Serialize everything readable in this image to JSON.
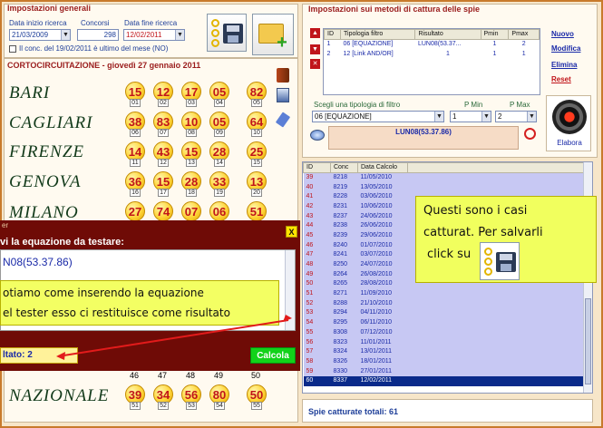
{
  "general": {
    "title": "Impostazioni generali",
    "date_start_label": "Data inizio ricerca",
    "date_start": "21/03/2009",
    "contests_label": "Concorsi",
    "contests": "298",
    "date_end_label": "Data fine ricerca",
    "date_end": "12/02/2011",
    "checkbox_label": "Il conc. del 19/02/2011 è ultimo del mese (NO)"
  },
  "draw": {
    "title": "CORTOCIRCUITAZIONE - giovedì 27 gennaio 2011",
    "wheels": [
      {
        "name": "BARI",
        "numbers": [
          "15",
          "12",
          "17",
          "05",
          "82"
        ],
        "idx": [
          "01",
          "02",
          "03",
          "04",
          "05"
        ]
      },
      {
        "name": "CAGLIARI",
        "numbers": [
          "38",
          "83",
          "10",
          "05",
          "64"
        ],
        "idx": [
          "06",
          "07",
          "08",
          "09",
          "10"
        ]
      },
      {
        "name": "FIRENZE",
        "numbers": [
          "14",
          "43",
          "15",
          "28",
          "25"
        ],
        "idx": [
          "11",
          "12",
          "13",
          "14",
          "15"
        ]
      },
      {
        "name": "GENOVA",
        "numbers": [
          "36",
          "15",
          "28",
          "33",
          "13"
        ],
        "idx": [
          "16",
          "17",
          "18",
          "19",
          "20"
        ]
      },
      {
        "name": "MILANO",
        "numbers": [
          "27",
          "74",
          "07",
          "06",
          "51"
        ],
        "idx": []
      },
      {
        "name": "NAZIONALE",
        "numbers": [
          "39",
          "34",
          "56",
          "80",
          "50"
        ],
        "idx": [
          "51",
          "52",
          "53",
          "54",
          "55"
        ]
      }
    ],
    "hidden_idx": [
      "46",
      "47",
      "48",
      "49",
      "50"
    ]
  },
  "spies": {
    "title": "Impostazioni sui metodi di cattura delle spie",
    "columns": [
      "ID",
      "Tipologia filtro",
      "Risultato",
      "Pmin",
      "Pmax"
    ],
    "rows": [
      {
        "id": "1",
        "tipo": "06 [EQUAZIONE]",
        "ris": "LUN08(53.37...",
        "pmin": "1",
        "pmax": "2"
      },
      {
        "id": "2",
        "tipo": "12 [Link AND/OR]",
        "ris": "1",
        "pmin": "1",
        "pmax": "1"
      }
    ],
    "links": {
      "new": "Nuovo",
      "edit": "Modifica",
      "delete": "Elimina",
      "reset": "Reset"
    },
    "filter_label": "Scegli una tipologia di filtro",
    "pmin_label": "P Min",
    "pmax_label": "P Max",
    "filter_value": "06 [EQUAZIONE]",
    "pmin_value": "1",
    "pmax_value": "2",
    "expression": "LUN08(53.37.86)",
    "run_label": "Elabora"
  },
  "results": {
    "columns": [
      "ID",
      "Conc",
      "Data Calcolo"
    ],
    "rows": [
      [
        "39",
        "8218",
        "11/05/2010"
      ],
      [
        "40",
        "8219",
        "13/05/2010"
      ],
      [
        "41",
        "8228",
        "03/06/2010"
      ],
      [
        "42",
        "8231",
        "10/06/2010"
      ],
      [
        "43",
        "8237",
        "24/06/2010"
      ],
      [
        "44",
        "8238",
        "26/06/2010"
      ],
      [
        "45",
        "8239",
        "29/06/2010"
      ],
      [
        "46",
        "8240",
        "01/07/2010"
      ],
      [
        "47",
        "8241",
        "03/07/2010"
      ],
      [
        "48",
        "8250",
        "24/07/2010"
      ],
      [
        "49",
        "8264",
        "26/08/2010"
      ],
      [
        "50",
        "8265",
        "28/08/2010"
      ],
      [
        "51",
        "8271",
        "11/09/2010"
      ],
      [
        "52",
        "8288",
        "21/10/2010"
      ],
      [
        "53",
        "8294",
        "04/11/2010"
      ],
      [
        "54",
        "8295",
        "06/11/2010"
      ],
      [
        "55",
        "8308",
        "07/12/2010"
      ],
      [
        "56",
        "8323",
        "11/01/2011"
      ],
      [
        "57",
        "8324",
        "13/01/2011"
      ],
      [
        "58",
        "8326",
        "18/01/2011"
      ],
      [
        "59",
        "8330",
        "27/01/2011"
      ],
      [
        "60",
        "8337",
        "12/02/2011"
      ]
    ],
    "total_label": "Spie catturate totali: 61"
  },
  "callout_right": {
    "line1": "Questi sono i casi",
    "line2": "catturat. Per salvarli",
    "line3": "click su"
  },
  "tester": {
    "title_fragment": "er",
    "close": "X",
    "prompt": "vi la equazione da testare:",
    "equation": "N08(53.37.86)",
    "note_line1": "otiamo come inserendo la equazione",
    "note_line2": "el tester esso ci restituisce come risultato",
    "result": "ltato: 2",
    "run": "Calcola"
  },
  "colors": {
    "accent_red": "#c0141a",
    "selected_row": "#0a2a8a",
    "grid_row": "#c7c8f3",
    "link_blue": "#1a2aa8"
  }
}
